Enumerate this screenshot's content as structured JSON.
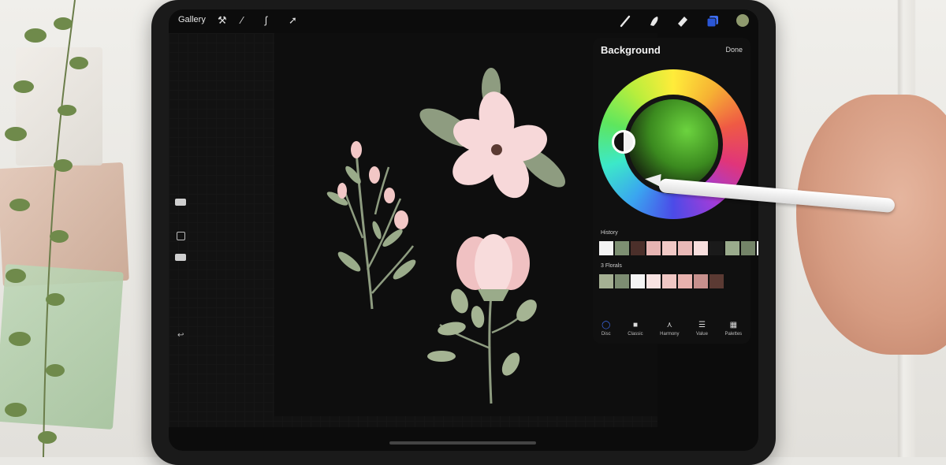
{
  "topbar": {
    "gallery_label": "Gallery",
    "left_tools": [
      "wrench-icon",
      "magic-wand-icon",
      "selection-icon",
      "transform-arrow-icon"
    ],
    "right_tools": [
      "brush-icon",
      "smudge-icon",
      "eraser-icon",
      "layers-icon",
      "color-icon"
    ],
    "current_color": "#8f9a6e"
  },
  "panel": {
    "title": "Background",
    "done_label": "Done",
    "history_label": "History",
    "history_colors": [
      "#f4f4f4",
      "#7d8f72",
      "#4b2f2a",
      "#e6b4b2",
      "#f1c9c6",
      "#e9b9b7",
      "#f7dedd",
      "#1a1a1a",
      "#9aab8c",
      "#748468",
      "#f2f2f2"
    ],
    "palette_label": "3 Florals",
    "palette_colors": [
      "#a5b093",
      "#7d8d72",
      "#f4f4f4",
      "#f8e3e2",
      "#f0c7c4",
      "#e8b2ae",
      "#c7908d",
      "#5b3a33"
    ],
    "tabs": [
      {
        "label": "Disc",
        "icon": "disc-icon"
      },
      {
        "label": "Classic",
        "icon": "classic-square-icon"
      },
      {
        "label": "Harmony",
        "icon": "harmony-icon"
      },
      {
        "label": "Value",
        "icon": "value-sliders-icon"
      },
      {
        "label": "Palettes",
        "icon": "palettes-grid-icon"
      }
    ]
  },
  "sidebar": {
    "undo_icon": "undo-icon"
  }
}
